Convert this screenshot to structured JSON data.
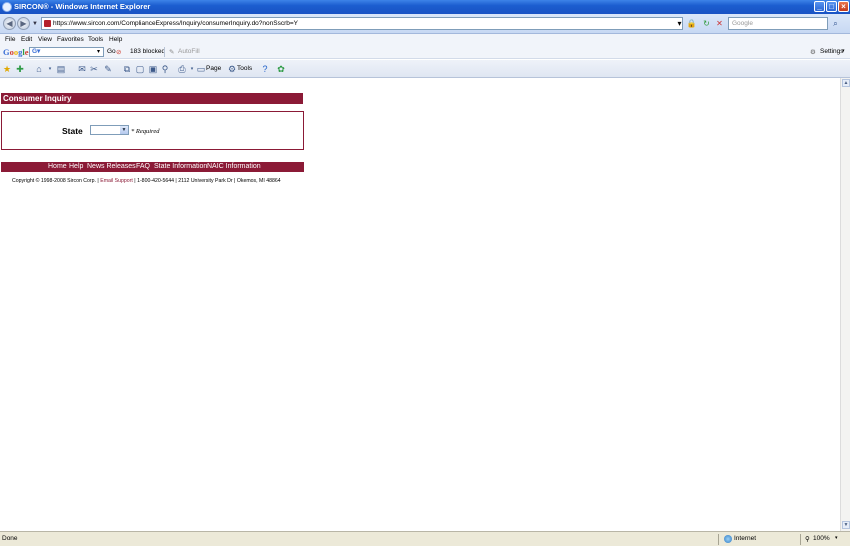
{
  "window": {
    "title": "SIRCON® - Windows Internet Explorer"
  },
  "address_bar": {
    "url": "https://www.sircon.com/ComplianceExpress/Inquiry/consumerInquiry.do?nonSscrb=Y",
    "search_placeholder": "Google"
  },
  "menu": [
    "File",
    "Edit",
    "View",
    "Favorites",
    "Tools",
    "Help"
  ],
  "google_toolbar": {
    "logo": "Google",
    "go_label": "Go",
    "blocked_label": "183 blocked",
    "autofill_label": "AutoFill",
    "settings_label": "Settings"
  },
  "command_bar": {
    "page_label": "Page",
    "tools_label": "Tools"
  },
  "page": {
    "banner_title": "Consumer Inquiry",
    "form": {
      "state_label": "State",
      "state_value": "",
      "required_note": "* Required"
    },
    "footer_nav": [
      "Home",
      "Help",
      "News Releases",
      "FAQ",
      "State Information",
      "NAIC Information"
    ],
    "copyright_prefix": "Copyright © 1998-2008 Sircon Corp. |",
    "email_support": "Email Support",
    "copyright_suffix": "| 1-800-420-5644 | 2112 University Park Dr | Okemos, MI 48864"
  },
  "status_bar": {
    "status": "Done",
    "zone": "Internet",
    "zoom": "100%"
  },
  "colors": {
    "brand": "#8b1a36",
    "titlebar": "#1b5dcf"
  }
}
